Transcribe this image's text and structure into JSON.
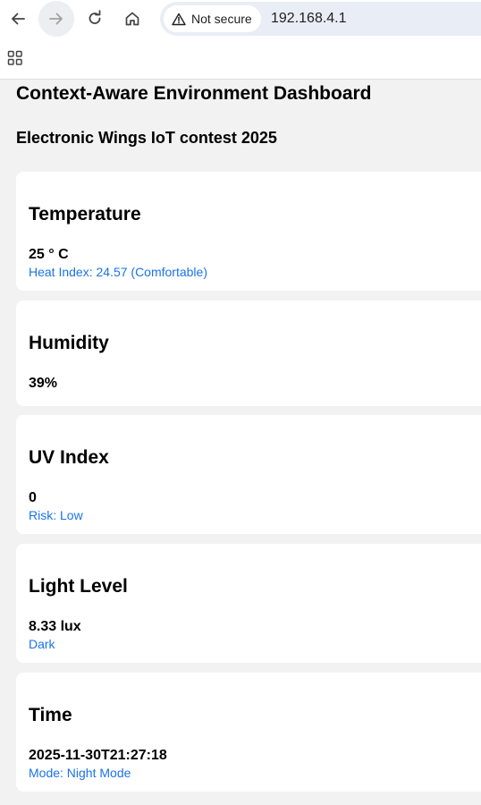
{
  "browser": {
    "security_label": "Not secure",
    "url": "192.168.4.1",
    "icons": [
      "back-arrow-icon",
      "forward-arrow-icon",
      "reload-icon",
      "home-icon",
      "warning-icon",
      "apps-grid-icon"
    ]
  },
  "page": {
    "title": "Context-Aware Environment Dashboard",
    "subtitle": "Electronic Wings IoT contest 2025"
  },
  "cards": {
    "temperature": {
      "title": "Temperature",
      "value": "25 ° C",
      "sub": "Heat Index: 24.57 (Comfortable)"
    },
    "humidity": {
      "title": "Humidity",
      "value": "39%"
    },
    "uv": {
      "title": "UV Index",
      "value": "0",
      "sub": "Risk: Low"
    },
    "light": {
      "title": "Light Level",
      "value": "8.33 lux",
      "sub": "Dark"
    },
    "time": {
      "title": "Time",
      "value": "2025-11-30T21:27:18",
      "sub": "Mode: Night Mode"
    }
  },
  "colors": {
    "page_bg": "#f2f2f2",
    "card_bg": "#ffffff",
    "accent_text": "#1a73e8",
    "omnibox_bg": "#e9edf5"
  }
}
